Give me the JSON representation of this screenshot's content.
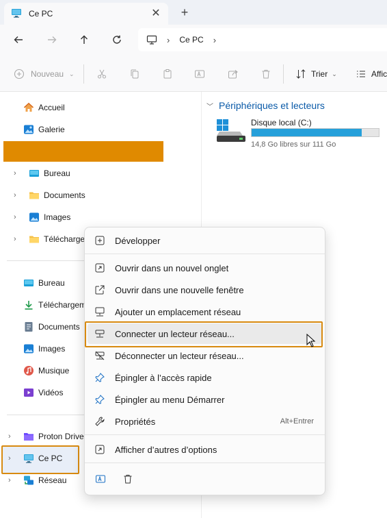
{
  "window": {
    "tab_title": "Ce PC",
    "close_glyph": "✕",
    "new_tab_glyph": "+"
  },
  "address": {
    "crumbs": [
      "Ce PC"
    ],
    "separator": "›"
  },
  "commands": {
    "new_label": "Nouveau",
    "sort_label": "Trier",
    "view_label": "Affic"
  },
  "sidebar": {
    "top_items": [
      {
        "label": "Accueil",
        "icon": "home-icon"
      },
      {
        "label": "Galerie",
        "icon": "gallery-icon"
      }
    ],
    "pinned_items": [
      {
        "label": "Bureau",
        "icon": "desktop-folder-icon"
      },
      {
        "label": "Documents",
        "icon": "folder-icon"
      },
      {
        "label": "Images",
        "icon": "pictures-icon"
      },
      {
        "label": "Téléchargements",
        "icon": "folder-icon"
      }
    ],
    "library_items": [
      {
        "label": "Bureau",
        "icon": "desktop-folder-icon"
      },
      {
        "label": "Téléchargements",
        "icon": "download-icon"
      },
      {
        "label": "Documents",
        "icon": "documents-icon"
      },
      {
        "label": "Images",
        "icon": "pictures-icon"
      },
      {
        "label": "Musique",
        "icon": "music-icon"
      },
      {
        "label": "Vidéos",
        "icon": "videos-icon"
      }
    ],
    "bottom_items": [
      {
        "label": "Proton Drive",
        "icon": "proton-drive-icon"
      },
      {
        "label": "Ce PC",
        "icon": "computer-icon"
      },
      {
        "label": "Réseau",
        "icon": "network-icon"
      }
    ]
  },
  "main": {
    "group_title": "Périphériques et lecteurs",
    "drive": {
      "name": "Disque local (C:)",
      "free_text": "14,8 Go libres sur 111 Go",
      "used_fraction": 0.867
    }
  },
  "context_menu": {
    "items": [
      {
        "label": "Développer",
        "icon": "expand-icon"
      },
      {
        "label": "Ouvrir dans un nouvel onglet",
        "icon": "open-new-tab-icon"
      },
      {
        "label": "Ouvrir dans une nouvelle fenêtre",
        "icon": "open-new-window-icon"
      },
      {
        "label": "Ajouter un emplacement réseau",
        "icon": "network-location-icon"
      },
      {
        "label": "Connecter un lecteur réseau...",
        "icon": "map-network-drive-icon"
      },
      {
        "label": "Déconnecter un lecteur réseau...",
        "icon": "disconnect-network-drive-icon"
      },
      {
        "label": "Épingler à l’accès rapide",
        "icon": "pin-icon"
      },
      {
        "label": "Épingler au menu Démarrer",
        "icon": "pin-start-icon"
      },
      {
        "label": "Propriétés",
        "icon": "wrench-icon",
        "shortcut": "Alt+Entrer"
      },
      {
        "label": "Afficher d’autres d’options",
        "icon": "more-options-icon"
      }
    ]
  },
  "colors": {
    "accent": "#0a5aa8",
    "highlight_border": "#d88a10",
    "orange_bar": "#e08a00",
    "drive_fill": "#26a0da"
  }
}
